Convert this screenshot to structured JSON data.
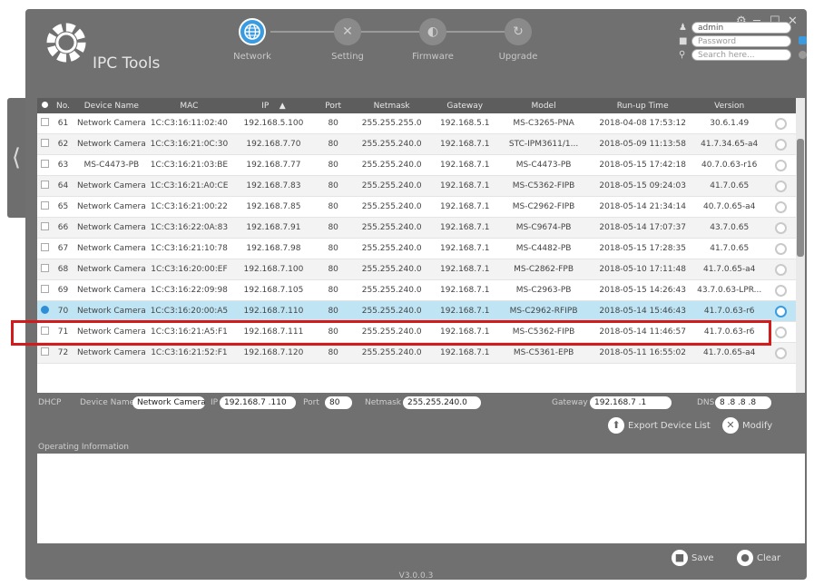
{
  "app": {
    "title": "IPC Tools",
    "version": "V3.0.0.3",
    "window_controls": [
      "⚙",
      "─",
      "☐",
      "✕"
    ]
  },
  "wizard": {
    "steps": [
      {
        "label": "Network",
        "icon": "globe-icon",
        "active": true
      },
      {
        "label": "Setting",
        "icon": "wrench-icon",
        "active": false
      },
      {
        "label": "Firmware",
        "icon": "firmware-icon",
        "active": false
      },
      {
        "label": "Upgrade",
        "icon": "upgrade-icon",
        "active": false
      }
    ]
  },
  "login": {
    "username_value": "admin",
    "password_placeholder": "Password",
    "search_placeholder": "Search here..."
  },
  "table": {
    "headers": [
      "",
      "No.",
      "Device Name",
      "MAC",
      "IP",
      "Port",
      "Netmask",
      "Gateway",
      "Model",
      "Run-up Time",
      "Version",
      ""
    ],
    "sort_indicator": "▲",
    "rows": [
      {
        "no": "61",
        "name": "Network Camera",
        "mac": "1C:C3:16:11:02:40",
        "ip": "192.168.5.100",
        "port": "80",
        "mask": "255.255.255.0",
        "gw": "192.168.5.1",
        "model": "MS-C3265-PNA",
        "runup": "2018-04-08 17:53:12",
        "ver": "30.6.1.49",
        "selected": false
      },
      {
        "no": "62",
        "name": "Network Camera",
        "mac": "1C:C3:16:21:0C:30",
        "ip": "192.168.7.70",
        "port": "80",
        "mask": "255.255.240.0",
        "gw": "192.168.7.1",
        "model": "STC-IPM3611/1...",
        "runup": "2018-05-09 11:13:58",
        "ver": "41.7.34.65-a4",
        "selected": false
      },
      {
        "no": "63",
        "name": "MS-C4473-PB",
        "mac": "1C:C3:16:21:03:BE",
        "ip": "192.168.7.77",
        "port": "80",
        "mask": "255.255.240.0",
        "gw": "192.168.7.1",
        "model": "MS-C4473-PB",
        "runup": "2018-05-15 17:42:18",
        "ver": "40.7.0.63-r16",
        "selected": false
      },
      {
        "no": "64",
        "name": "Network Camera",
        "mac": "1C:C3:16:21:A0:CE",
        "ip": "192.168.7.83",
        "port": "80",
        "mask": "255.255.240.0",
        "gw": "192.168.7.1",
        "model": "MS-C5362-FIPB",
        "runup": "2018-05-15 09:24:03",
        "ver": "41.7.0.65",
        "selected": false
      },
      {
        "no": "65",
        "name": "Network Camera",
        "mac": "1C:C3:16:21:00:22",
        "ip": "192.168.7.85",
        "port": "80",
        "mask": "255.255.240.0",
        "gw": "192.168.7.1",
        "model": "MS-C2962-FIPB",
        "runup": "2018-05-14 21:34:14",
        "ver": "40.7.0.65-a4",
        "selected": false
      },
      {
        "no": "66",
        "name": "Network Camera",
        "mac": "1C:C3:16:22:0A:83",
        "ip": "192.168.7.91",
        "port": "80",
        "mask": "255.255.240.0",
        "gw": "192.168.7.1",
        "model": "MS-C9674-PB",
        "runup": "2018-05-14 17:07:37",
        "ver": "43.7.0.65",
        "selected": false
      },
      {
        "no": "67",
        "name": "Network Camera",
        "mac": "1C:C3:16:21:10:78",
        "ip": "192.168.7.98",
        "port": "80",
        "mask": "255.255.240.0",
        "gw": "192.168.7.1",
        "model": "MS-C4482-PB",
        "runup": "2018-05-15 17:28:35",
        "ver": "41.7.0.65",
        "selected": false
      },
      {
        "no": "68",
        "name": "Network Camera",
        "mac": "1C:C3:16:20:00:EF",
        "ip": "192.168.7.100",
        "port": "80",
        "mask": "255.255.240.0",
        "gw": "192.168.7.1",
        "model": "MS-C2862-FPB",
        "runup": "2018-05-10 17:11:48",
        "ver": "41.7.0.65-a4",
        "selected": false
      },
      {
        "no": "69",
        "name": "Network Camera",
        "mac": "1C:C3:16:22:09:98",
        "ip": "192.168.7.105",
        "port": "80",
        "mask": "255.255.240.0",
        "gw": "192.168.7.1",
        "model": "MS-C2963-PB",
        "runup": "2018-05-15 14:26:43",
        "ver": "43.7.0.63-LPR...",
        "selected": false
      },
      {
        "no": "70",
        "name": "Network Camera",
        "mac": "1C:C3:16:20:00:A5",
        "ip": "192.168.7.110",
        "port": "80",
        "mask": "255.255.240.0",
        "gw": "192.168.7.1",
        "model": "MS-C2962-RFIPB",
        "runup": "2018-05-14 15:46:43",
        "ver": "41.7.0.63-r6",
        "selected": true
      },
      {
        "no": "71",
        "name": "Network Camera",
        "mac": "1C:C3:16:21:A5:F1",
        "ip": "192.168.7.111",
        "port": "80",
        "mask": "255.255.240.0",
        "gw": "192.168.7.1",
        "model": "MS-C5362-FIPB",
        "runup": "2018-05-14 11:46:57",
        "ver": "41.7.0.63-r6",
        "selected": false
      },
      {
        "no": "72",
        "name": "Network Camera",
        "mac": "1C:C3:16:21:52:F1",
        "ip": "192.168.7.120",
        "port": "80",
        "mask": "255.255.240.0",
        "gw": "192.168.7.1",
        "model": "MS-C5361-EPB",
        "runup": "2018-05-11 16:55:02",
        "ver": "41.7.0.65-a4",
        "selected": false
      }
    ]
  },
  "edit": {
    "dhcp_label": "DHCP",
    "device_name_label": "Device Name",
    "device_name_value": "Network Camera",
    "ip_label": "IP",
    "ip_value": "192.168.7 .110",
    "port_label": "Port",
    "port_value": "80",
    "netmask_label": "Netmask",
    "netmask_value": "255.255.240.0",
    "gateway_label": "Gateway",
    "gateway_value": "192.168.7 .1",
    "dns_label": "DNS",
    "dns_value": "8 .8 .8 .8"
  },
  "actions": {
    "export_label": "Export Device List",
    "modify_label": "Modify",
    "save_label": "Save",
    "clear_label": "Clear"
  },
  "operating": {
    "label": "Operating Information"
  },
  "colors": {
    "frame": "#707070",
    "header_row": "#5d5d5d",
    "selected_row": "#bfe5f4",
    "highlight_box": "#d41b1b",
    "network_step": "#3a9be0"
  }
}
